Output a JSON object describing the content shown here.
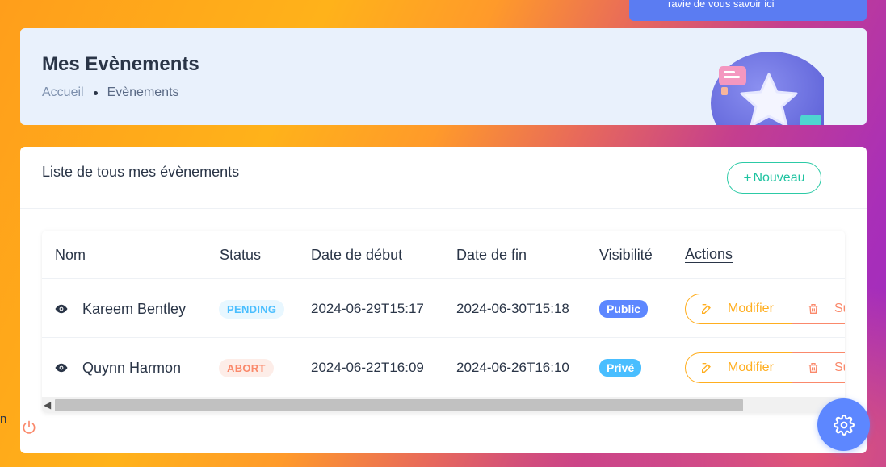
{
  "toast": {
    "text": "ravie de vous savoir ici"
  },
  "header": {
    "title": "Mes Evènements",
    "breadcrumb": {
      "home": "Accueil",
      "current": "Evènements"
    }
  },
  "card": {
    "title": "Liste de tous mes évènements",
    "new_button": {
      "icon": "+",
      "label": "Nouveau"
    }
  },
  "table": {
    "columns": [
      "Nom",
      "Status",
      "Date de début",
      "Date de fin",
      "Visibilité",
      "Actions"
    ],
    "rows": [
      {
        "name": "Kareem Bentley",
        "status": "PENDING",
        "start": "2024-06-29T15:17",
        "end": "2024-06-30T15:18",
        "visibility": "Public",
        "edit": "Modifier",
        "delete": "Su"
      },
      {
        "name": "Quynn Harmon",
        "status": "ABORT",
        "start": "2024-06-22T16:09",
        "end": "2024-06-26T16:10",
        "visibility": "Privé",
        "edit": "Modifier",
        "delete": "Su"
      }
    ]
  },
  "side": {
    "fragment": "n"
  },
  "colors": {
    "primary": "#5d87ff",
    "success": "#13deb9",
    "warning": "#ffae1f",
    "danger": "#fa896b",
    "info": "#49beff"
  },
  "icons": {
    "view": "eye-icon",
    "edit": "edit-icon",
    "delete": "trash-icon",
    "settings": "gear-icon",
    "power": "power-icon"
  }
}
